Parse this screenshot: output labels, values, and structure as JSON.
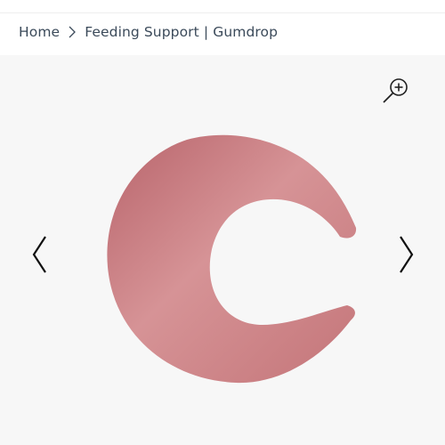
{
  "breadcrumb": {
    "home": "Home",
    "separator_icon": "chevron-right-icon",
    "current": "Feeding Support | Gumdrop"
  },
  "gallery": {
    "zoom_icon": "zoom-in-icon",
    "prev_icon": "chevron-left-icon",
    "next_icon": "chevron-right-icon",
    "product_color": "#c97b80"
  },
  "colors": {
    "text": "#3b4a5a",
    "gallery_bg": "#f7f7f7"
  }
}
